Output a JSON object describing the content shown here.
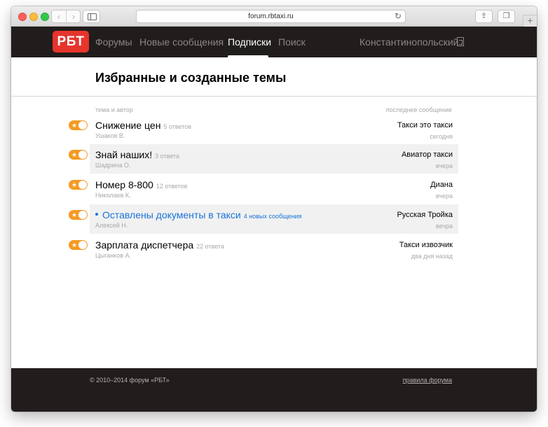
{
  "browser": {
    "url": "forum.rbtaxi.ru",
    "icons": {
      "back": "chevron-left-icon",
      "forward": "chevron-right-icon",
      "sidebar": "sidebar-icon",
      "reload": "reload-icon",
      "share": "share-icon",
      "tabs": "tabs-icon",
      "new_tab": "plus-icon"
    }
  },
  "header": {
    "logo": "РБТ",
    "nav": [
      {
        "label": "Форумы",
        "active": false
      },
      {
        "label": "Новые сообщения",
        "active": false
      },
      {
        "label": "Подписки",
        "active": true
      },
      {
        "label": "Поиск",
        "active": false
      }
    ],
    "user": "Константинопольский"
  },
  "page": {
    "title": "Избранные и созданные темы",
    "col_topic": "тема и автор",
    "col_last": "последнее сообщение"
  },
  "topics": [
    {
      "title": "Снижение цен",
      "replies": "5 ответов",
      "author": "Ушаков В.",
      "last_author": "Такси это такси",
      "last_time": "сегодня",
      "unread": false
    },
    {
      "title": "Знай наших!",
      "replies": "3 ответа",
      "author": "Шадрина О.",
      "last_author": "Авиатор такси",
      "last_time": "вчера",
      "unread": false
    },
    {
      "title": "Номер 8-800",
      "replies": "12 ответов",
      "author": "Николаев К.",
      "last_author": "Диана",
      "last_time": "вчера",
      "unread": false
    },
    {
      "title": "Оставлены документы в такси",
      "replies": "4 новых сообщения",
      "author": "Алексей Н.",
      "last_author": "Русская Тройка",
      "last_time": "вечра",
      "unread": true
    },
    {
      "title": "Зарплата диспетчера",
      "replies": "22 ответа",
      "author": "Цыганков А.",
      "last_author": "Такси извозчик",
      "last_time": "два дня назад",
      "unread": false
    }
  ],
  "footer": {
    "copyright": "© 2010–2014 форум «РБТ»",
    "rules": "правила форума"
  },
  "colors": {
    "brand": "#e7342c",
    "accent": "#f59a23",
    "link": "#1a73d9",
    "dark": "#211d1c"
  }
}
